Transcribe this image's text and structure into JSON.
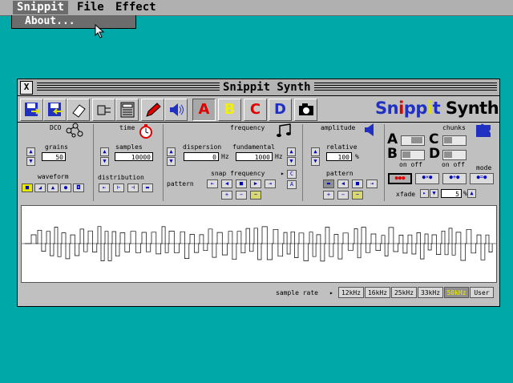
{
  "menubar": {
    "snippit": "Snippit",
    "file": "File",
    "effect": "Effect"
  },
  "dropdown": {
    "about": "About..."
  },
  "window": {
    "title": "Snippit Synth",
    "close": "X"
  },
  "toolbar": {
    "a": "A",
    "b": "B",
    "c": "C",
    "d": "D",
    "brand_sn": "Sn",
    "brand_i1": "i",
    "brand_pp": "pp",
    "brand_i2": "i",
    "brand_t": "t",
    "brand_synth": "Synth"
  },
  "dco": {
    "title": "DCO",
    "grains_label": "grains",
    "grains_value": "50",
    "waveform_label": "waveform"
  },
  "time": {
    "title": "time",
    "samples_label": "samples",
    "samples_value": "10000",
    "distribution_label": "distribution"
  },
  "frequency": {
    "title": "frequency",
    "dispersion_label": "dispersion",
    "dispersion_value": "0",
    "dispersion_unit": "Hz",
    "fundamental_label": "fundamental",
    "fundamental_value": "1000",
    "fundamental_unit": "Hz",
    "snap_label": "snap frequency",
    "pattern_label": "pattern"
  },
  "amplitude": {
    "title": "amplitude",
    "relative_label": "relative",
    "relative_value": "100",
    "relative_unit": "%",
    "pattern_label": "pattern"
  },
  "chunks": {
    "title": "chunks",
    "a": "A",
    "b": "B",
    "c": "C",
    "d": "D",
    "on_off_left": "on off",
    "on_off_right": "on off",
    "mode_label": "mode",
    "xfade_label": "xfade",
    "xfade_value": "5",
    "xfade_unit": "%"
  },
  "sample_rate": {
    "label": "sample rate",
    "options": [
      "12kHz",
      "16kHz",
      "25kHz",
      "33kHz",
      "50kHz",
      "User"
    ],
    "selected": "50kHz"
  },
  "colors": {
    "desktop": "#00a8a8",
    "accent_red": "#e00000",
    "accent_blue": "#0000d0",
    "accent_yellow": "#f0f000"
  }
}
